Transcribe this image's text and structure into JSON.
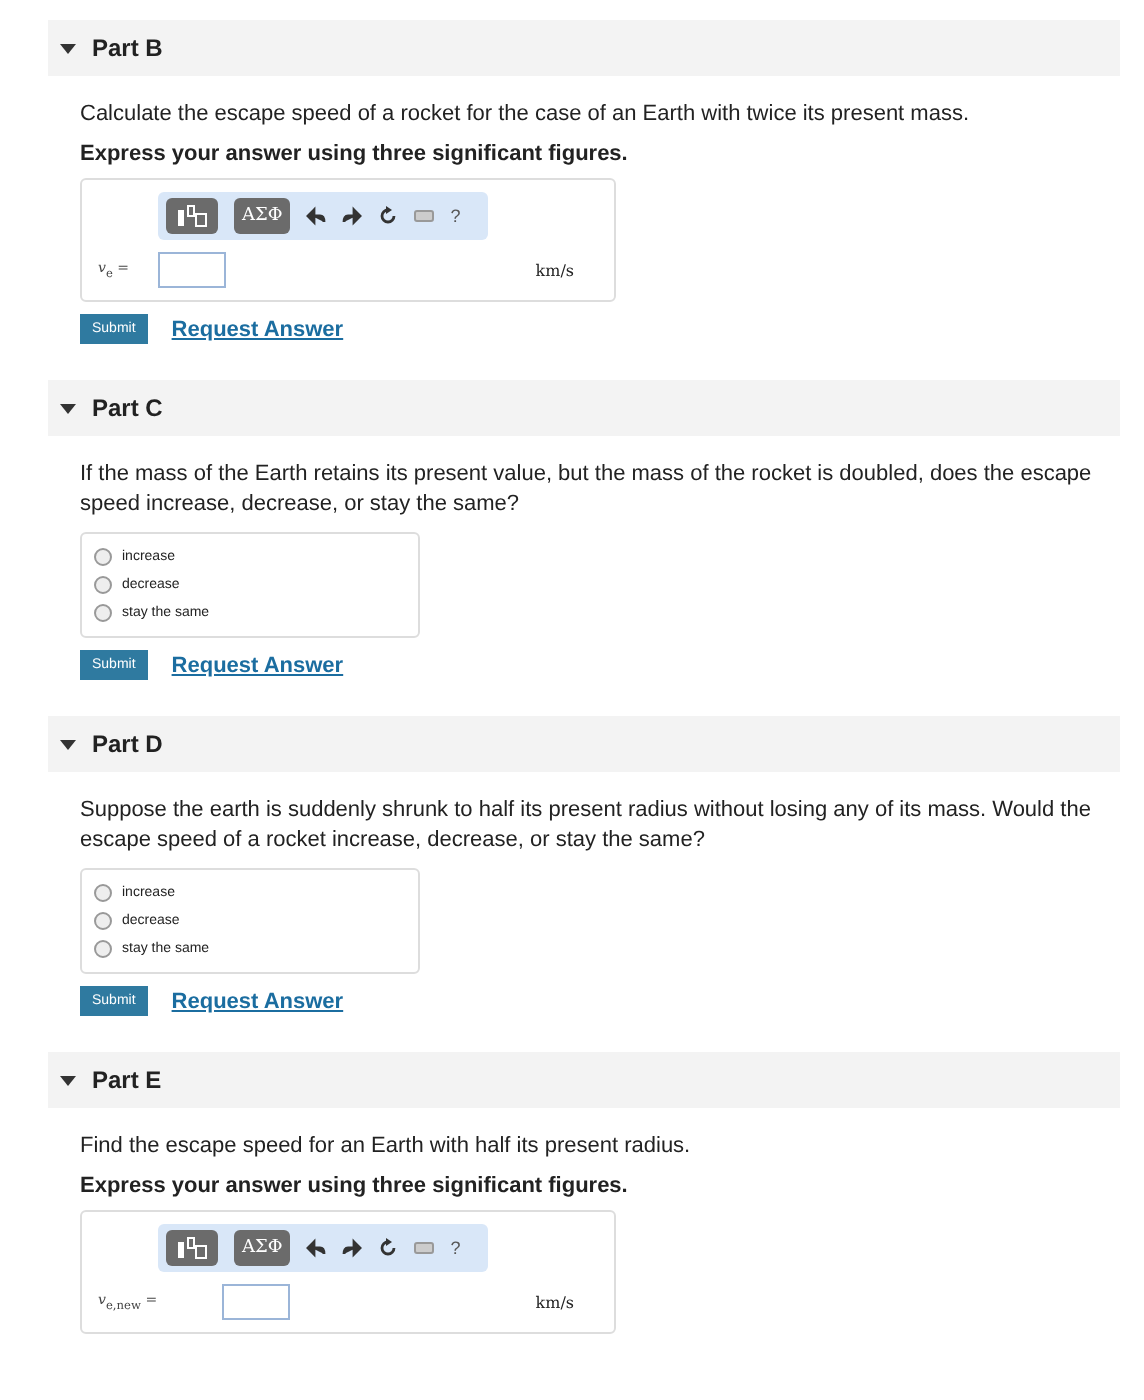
{
  "parts": [
    {
      "title": "Part B",
      "expanded": true,
      "kind": "numeric",
      "question": "Calculate the escape speed of a rocket for the case of an Earth with twice its present mass.",
      "instruction": "Express your answer using three significant figures.",
      "toolbar": {
        "templates_label": "ΑΣΦ",
        "help": "?"
      },
      "variable": "*v*$_{e}$ =",
      "unit": "km/s",
      "buttons": {
        "submit": "Submit",
        "request": "Request Answer"
      }
    },
    {
      "title": "Part C",
      "expanded": true,
      "kind": "choice",
      "question": "If the mass of the Earth retains its present value, but the mass of the rocket is doubled, does the escape speed increase, decrease, or stay the same?",
      "options": [
        {
          "label": "increase",
          "selected": false
        },
        {
          "label": "decrease",
          "selected": false
        },
        {
          "label": "stay the same",
          "selected": false
        }
      ],
      "buttons": {
        "submit": "Submit",
        "request": "Request Answer"
      }
    },
    {
      "title": "Part D",
      "expanded": true,
      "kind": "choice",
      "question": "Suppose the earth is suddenly shrunk to half its present radius without losing any of its mass. Would the escape speed of a rocket increase, decrease, or stay the same?",
      "options": [
        {
          "label": "increase",
          "selected": false
        },
        {
          "label": "decrease",
          "selected": false
        },
        {
          "label": "stay the same",
          "selected": false
        }
      ],
      "buttons": {
        "submit": "Submit",
        "request": "Request Answer"
      }
    },
    {
      "title": "Part E",
      "expanded": true,
      "kind": "numeric",
      "question": "Find the escape speed for an Earth with half its present radius.",
      "instruction": "Express your answer using three significant figures.",
      "toolbar": {
        "templates_label": "ΑΣΦ",
        "help": "?"
      },
      "variable": "*v*$_{e,new}$ =",
      "unit": "km/s"
    }
  ]
}
